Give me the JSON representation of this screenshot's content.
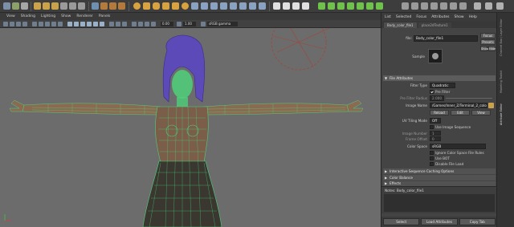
{
  "viewport": {
    "menu": [
      "View",
      "Shading",
      "Lighting",
      "Show",
      "Renderer",
      "Panels"
    ],
    "toolbar": {
      "value_a": "0.00",
      "value_b": "1.00",
      "color_space": "sRGB gamma"
    }
  },
  "side_strip": {
    "tabs": [
      "Channel Box / Layer Editor",
      "Modeling Toolkit",
      "Attribute Editor"
    ]
  },
  "attribute_editor": {
    "menu": [
      "List",
      "Selected",
      "Focus",
      "Attributes",
      "Show",
      "Help"
    ],
    "tabs": [
      "Body_color_file1",
      "place2dTexture1"
    ],
    "file_label": "file:",
    "file_name": "Body_color_file1",
    "focus_button": "Focus",
    "presets_button": "Presets",
    "show_button": "Show",
    "hide_button": "Hide",
    "sample_label": "Sample",
    "file_attributes": {
      "header": "File Attributes",
      "filter_type_label": "Filter Type",
      "filter_type_value": "Quadratic",
      "pre_filter_label": "Pre Filter",
      "pre_filter_radius_label": "Pre Filter Radius",
      "pre_filter_radius_value": "2.000",
      "image_name_label": "Image Name",
      "image_name_value": "/Games/Inner_Z/Terminal_2_color_recolour.jpg",
      "reload_button": "Reload",
      "edit_button": "Edit",
      "view_button": "View",
      "uv_tiling_label": "UV Tiling Mode",
      "uv_tiling_value": "Off",
      "use_image_sequence_label": "Use Image Sequence",
      "image_number_label": "Image Number",
      "image_number_value": "1",
      "frame_offset_label": "Frame Offset",
      "frame_offset_value": "0",
      "color_space_label": "Color Space",
      "color_space_value": "sRGB",
      "ignore_color_space_label": "Ignore Color Space File Rules",
      "use_bot_label": "Use BOT",
      "disable_file_load_label": "Disable File Load"
    },
    "sections": [
      "Interactive Sequence Caching Options",
      "Color Balance",
      "Effects"
    ],
    "notes_label": "Notes: Body_color_file1",
    "bottom_buttons": [
      "Select",
      "Load Attributes",
      "Copy Tab"
    ]
  }
}
